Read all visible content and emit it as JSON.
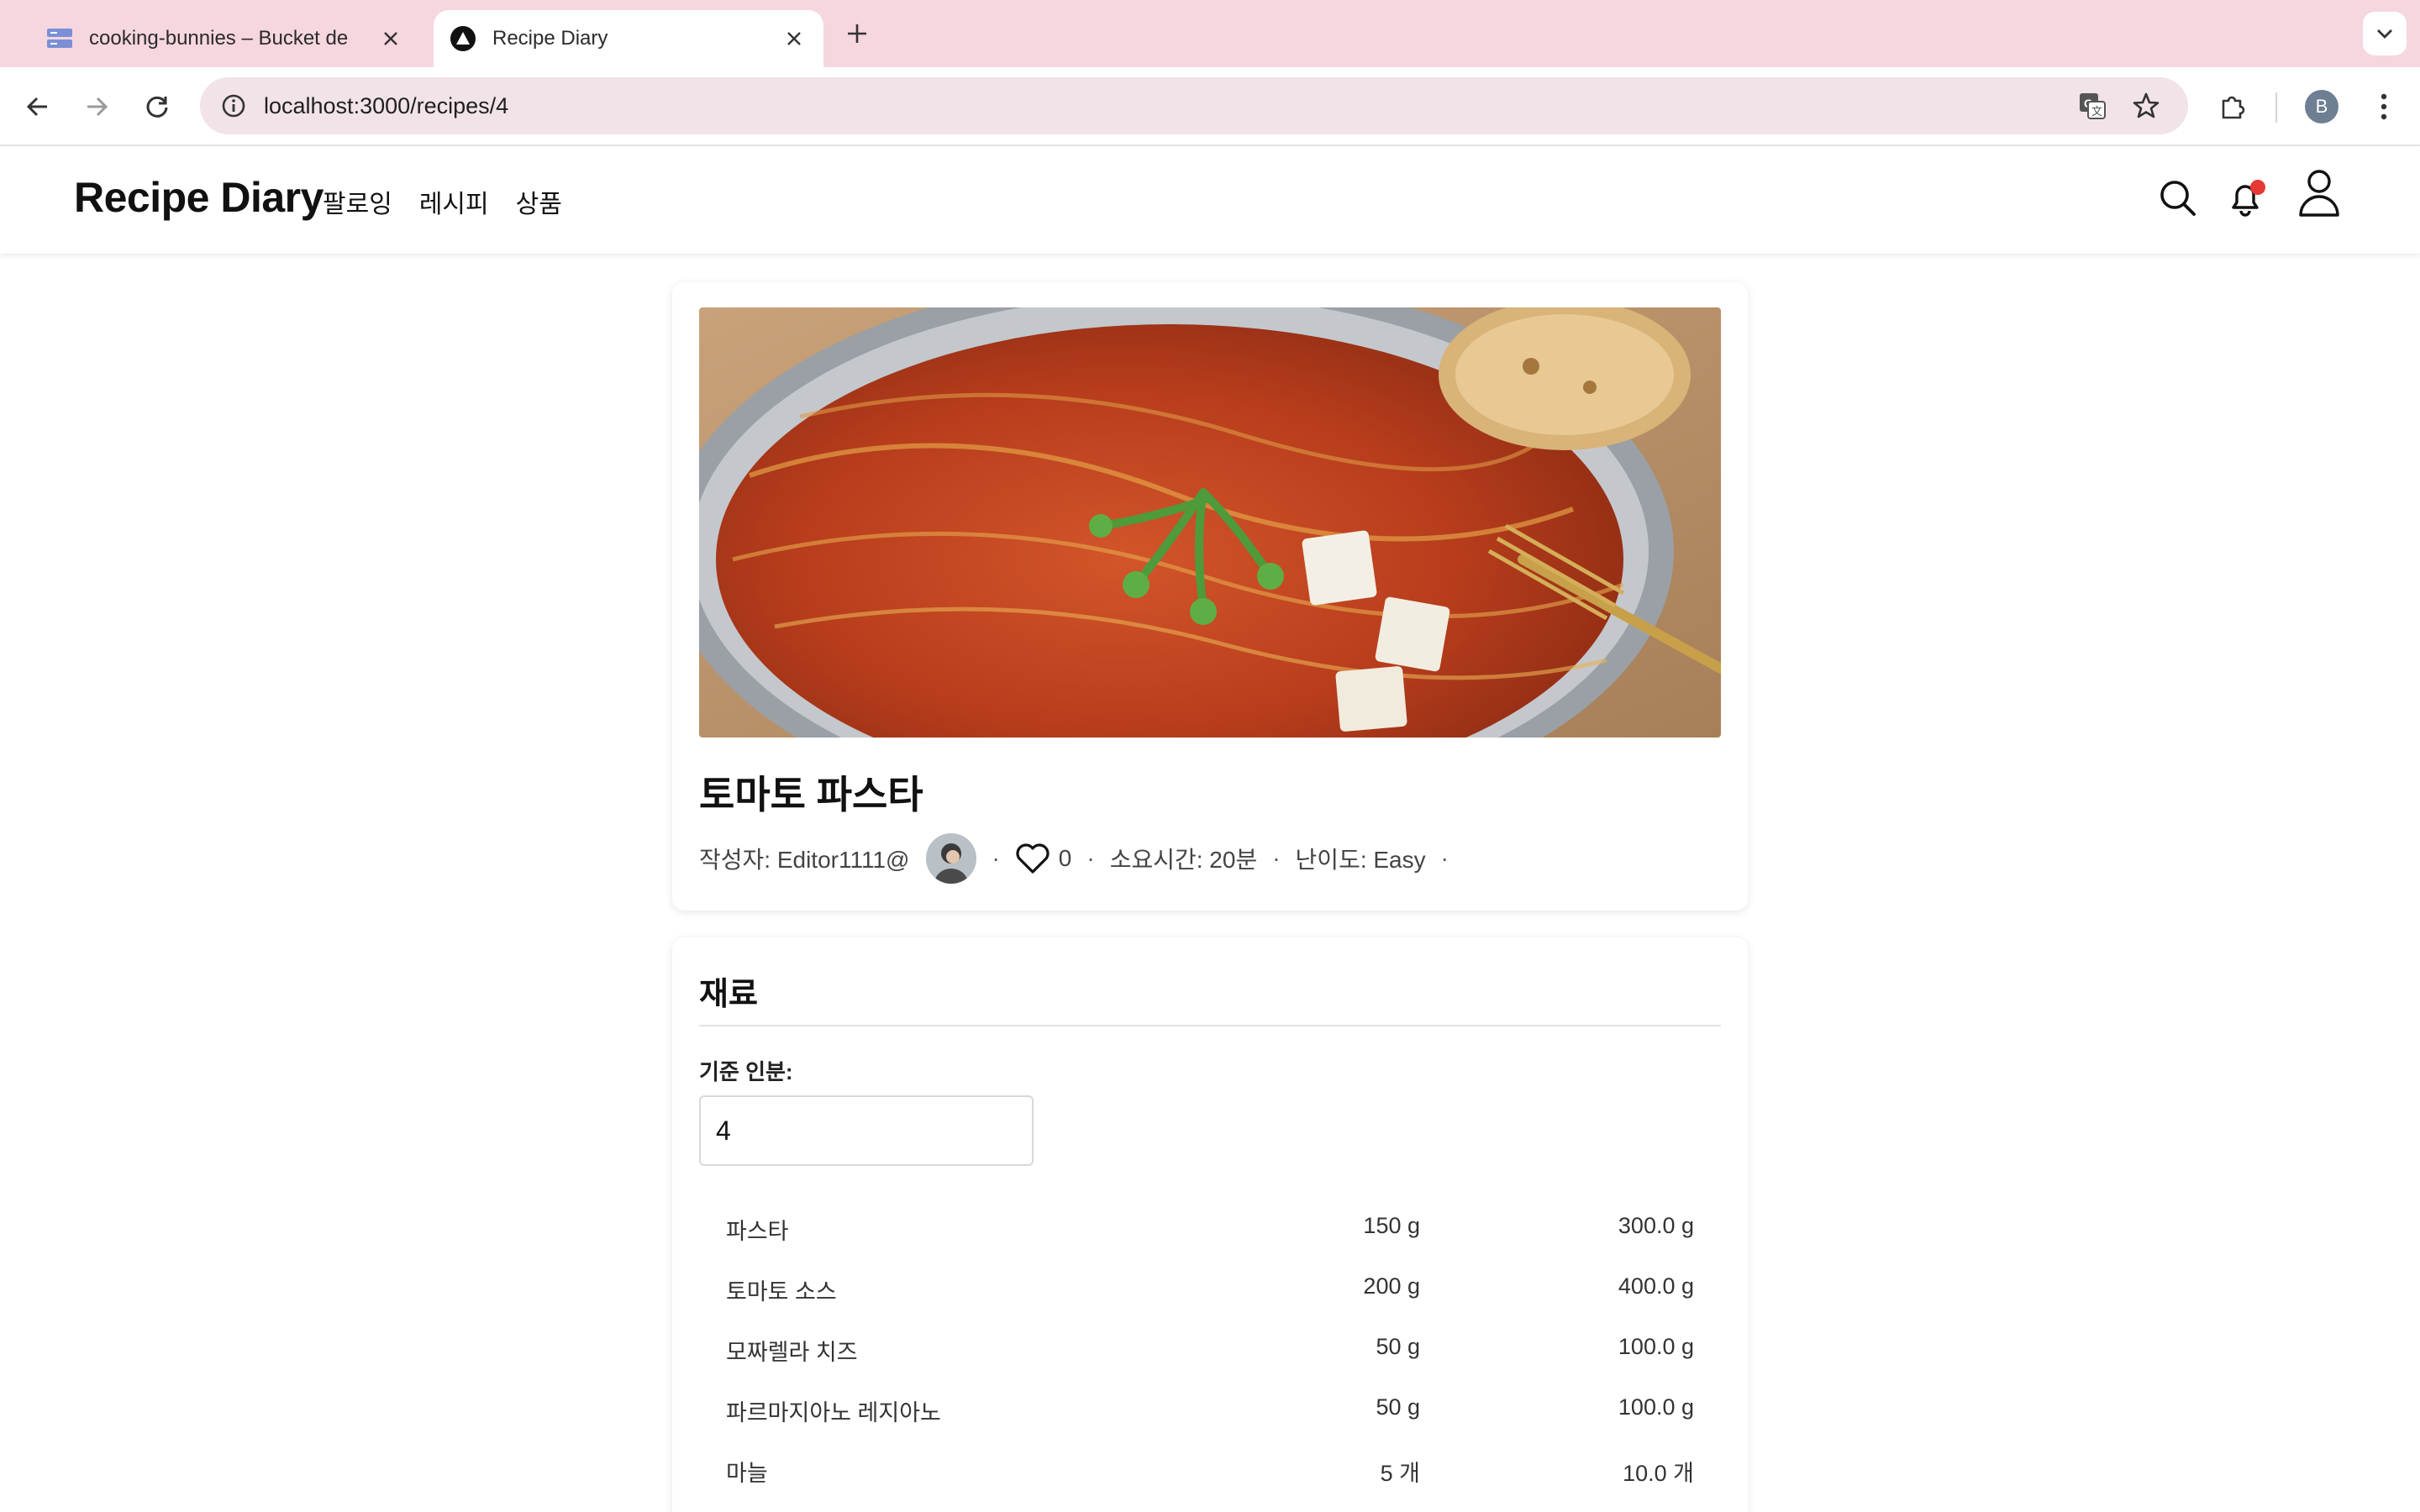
{
  "browser": {
    "tabs": [
      {
        "title": "cooking-bunnies – Bucket de",
        "active": false,
        "icon": "bucket-icon"
      },
      {
        "title": "Recipe Diary",
        "active": true,
        "icon": "triangle-logo-icon"
      }
    ],
    "url": "localhost:3000/recipes/4",
    "profile_initial": "B"
  },
  "header": {
    "brand": "Recipe Diary",
    "nav": [
      "팔로잉",
      "레시피",
      "상품"
    ],
    "has_notification": true
  },
  "recipe": {
    "title": "토마토 파스타",
    "author_label": "작성자: Editor1111@",
    "likes": "0",
    "time_label": "소요시간: 20분",
    "difficulty_label": "난이도: Easy",
    "separator": "·"
  },
  "ingredients": {
    "section_title": "재료",
    "serving_label": "기준 인분:",
    "serving_value": "4",
    "items": [
      {
        "name": "파스타",
        "base": "150 g",
        "scaled": "300.0 g"
      },
      {
        "name": "토마토 소스",
        "base": "200 g",
        "scaled": "400.0 g"
      },
      {
        "name": "모짜렐라 치즈",
        "base": "50 g",
        "scaled": "100.0 g"
      },
      {
        "name": "파르마지아노 레지아노",
        "base": "50 g",
        "scaled": "100.0 g"
      },
      {
        "name": "마늘",
        "base": "5 개",
        "scaled": "10.0 개"
      }
    ]
  },
  "colors": {
    "tabbar": "#f6d6df",
    "omnibox": "#f1e3e8",
    "notification_dot": "#e53935"
  }
}
